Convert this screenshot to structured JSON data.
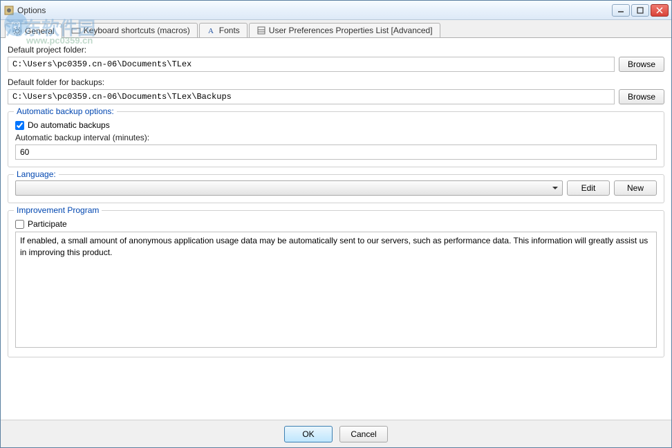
{
  "window": {
    "title": "Options"
  },
  "tabs": [
    {
      "label": "General"
    },
    {
      "label": "Keyboard shortcuts (macros)"
    },
    {
      "label": "Fonts"
    },
    {
      "label": "User Preferences Properties List [Advanced]"
    }
  ],
  "fields": {
    "project_folder_label": "Default project folder:",
    "project_folder_value": "C:\\Users\\pc0359.cn-06\\Documents\\TLex",
    "backup_folder_label": "Default folder for backups:",
    "backup_folder_value": "C:\\Users\\pc0359.cn-06\\Documents\\TLex\\Backups",
    "browse_label": "Browse"
  },
  "backup_group": {
    "title": "Automatic backup options:",
    "checkbox_label": "Do automatic backups",
    "checkbox_checked": true,
    "interval_label": "Automatic backup interval (minutes):",
    "interval_value": "60"
  },
  "language_group": {
    "title": "Language:",
    "selected": "",
    "edit_label": "Edit",
    "new_label": "New"
  },
  "improvement_group": {
    "title": "Improvement Program",
    "checkbox_label": "Participate",
    "checkbox_checked": false,
    "description": "If enabled, a small amount of anonymous application usage data may be automatically sent to our servers, such as performance data. This information will greatly assist us in improving this product."
  },
  "footer": {
    "ok_label": "OK",
    "cancel_label": "Cancel"
  },
  "watermark": {
    "text": "河东软件园",
    "sub": "www.pc0359.cn"
  }
}
